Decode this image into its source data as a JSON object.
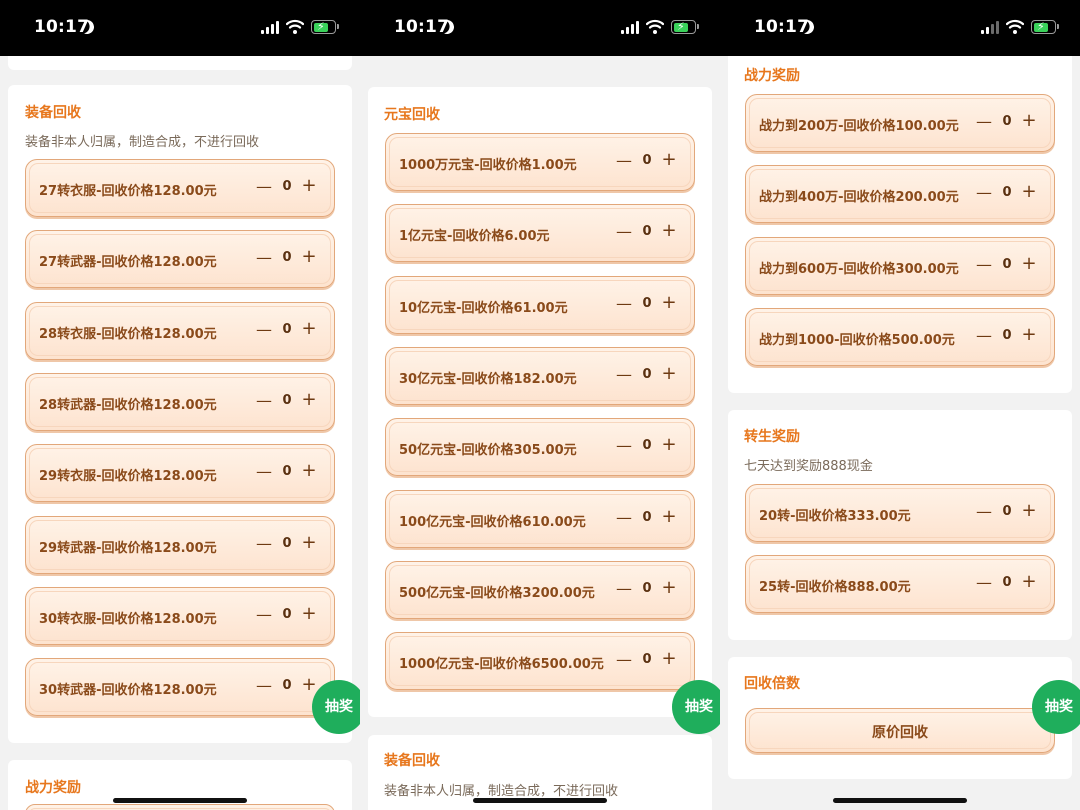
{
  "status_bar": {
    "time": "10:17"
  },
  "left": {
    "equipment_section": {
      "title": "装备回收",
      "note": "装备非本人归属，制造合成，不进行回收",
      "items": [
        {
          "label": "27转衣服-回收价格128.00元",
          "count": "0"
        },
        {
          "label": "27转武器-回收价格128.00元",
          "count": "0"
        },
        {
          "label": "28转衣服-回收价格128.00元",
          "count": "0"
        },
        {
          "label": "28转武器-回收价格128.00元",
          "count": "0"
        },
        {
          "label": "29转衣服-回收价格128.00元",
          "count": "0"
        },
        {
          "label": "29转武器-回收价格128.00元",
          "count": "0"
        },
        {
          "label": "30转衣服-回收价格128.00元",
          "count": "0"
        },
        {
          "label": "30转武器-回收价格128.00元",
          "count": "0"
        }
      ]
    },
    "power_section": {
      "title": "战力奖励"
    },
    "lottery_label": "抽奖"
  },
  "middle": {
    "yuanbao_section": {
      "title": "元宝回收",
      "items": [
        {
          "label": "1000万元宝-回收价格1.00元",
          "count": "0"
        },
        {
          "label": "1亿元宝-回收价格6.00元",
          "count": "0"
        },
        {
          "label": "10亿元宝-回收价格61.00元",
          "count": "0"
        },
        {
          "label": "30亿元宝-回收价格182.00元",
          "count": "0"
        },
        {
          "label": "50亿元宝-回收价格305.00元",
          "count": "0"
        },
        {
          "label": "100亿元宝-回收价格610.00元",
          "count": "0"
        },
        {
          "label": "500亿元宝-回收价格3200.00元",
          "count": "0"
        },
        {
          "label": "1000亿元宝-回收价格6500.00元",
          "count": "0"
        }
      ]
    },
    "equipment_section": {
      "title": "装备回收",
      "note": "装备非本人归属，制造合成，不进行回收"
    },
    "lottery_label": "抽奖"
  },
  "right": {
    "power_section": {
      "title": "战力奖励",
      "items": [
        {
          "label": "战力到200万-回收价格100.00元",
          "count": "0"
        },
        {
          "label": "战力到400万-回收价格200.00元",
          "count": "0"
        },
        {
          "label": "战力到600万-回收价格300.00元",
          "count": "0"
        },
        {
          "label": "战力到1000-回收价格500.00元",
          "count": "0"
        }
      ]
    },
    "rebirth_section": {
      "title": "转生奖励",
      "note": "七天达到奖励888现金",
      "items": [
        {
          "label": "20转-回收价格333.00元",
          "count": "0"
        },
        {
          "label": "25转-回收价格888.00元",
          "count": "0"
        }
      ]
    },
    "multiplier_section": {
      "title": "回收倍数",
      "option": "原价回收"
    },
    "lottery_label": "抽奖"
  },
  "colors": {
    "accent": "#e7771d",
    "item_text": "#8a4a1a",
    "lottery_button": "#1fae5c",
    "item_border": "#e2a77a"
  }
}
